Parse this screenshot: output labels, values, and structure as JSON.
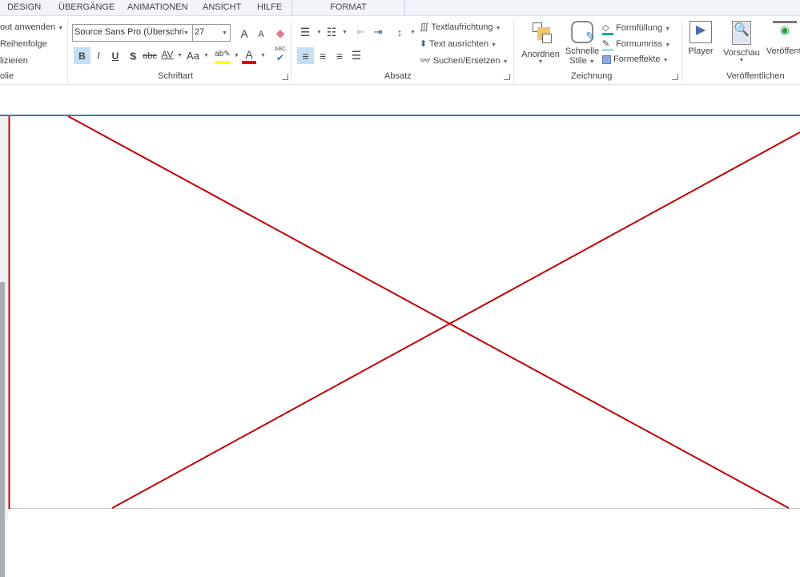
{
  "tabs": [
    "DESIGN",
    "ÜBERGÄNGE",
    "ANIMATIONEN",
    "ANSICHT",
    "HILFE"
  ],
  "context_tab": "FORMAT",
  "folie_group": {
    "items": [
      "out anwenden",
      "Reihenfolge",
      "lizieren"
    ],
    "label": "olie"
  },
  "schriftart": {
    "font": "Source Sans Pro (Überschrift",
    "size": "27",
    "label": "Schriftart",
    "bold": "B",
    "italic": "I",
    "underline": "U",
    "shadow": "S",
    "strike": "abc",
    "spacing": "AV",
    "case": "Aa",
    "grow": "A",
    "shrink": "A",
    "spell": "ABC"
  },
  "absatz": {
    "label": "Absatz",
    "textrichtung": "Textlaufrichtung",
    "ausrichten": "Text ausrichten",
    "suchen": "Suchen/Ersetzen"
  },
  "zeichnung": {
    "label": "Zeichnung",
    "anordnen": "Anordnen",
    "schnelle": "Schnelle",
    "stile": "Stile",
    "fuellung": "Formfüllung",
    "umriss": "Formumriss",
    "effekte": "Formeffekte"
  },
  "veroeffentlichen": {
    "label": "Veröffentlichen",
    "player": "Player",
    "vorschau": "Vorschau",
    "veroeff": "Veröffentl"
  },
  "colors": {
    "accent": "#2f7fc1",
    "line": "#c00000",
    "highlight": "#ffff00",
    "fontcolor": "#e00000"
  }
}
